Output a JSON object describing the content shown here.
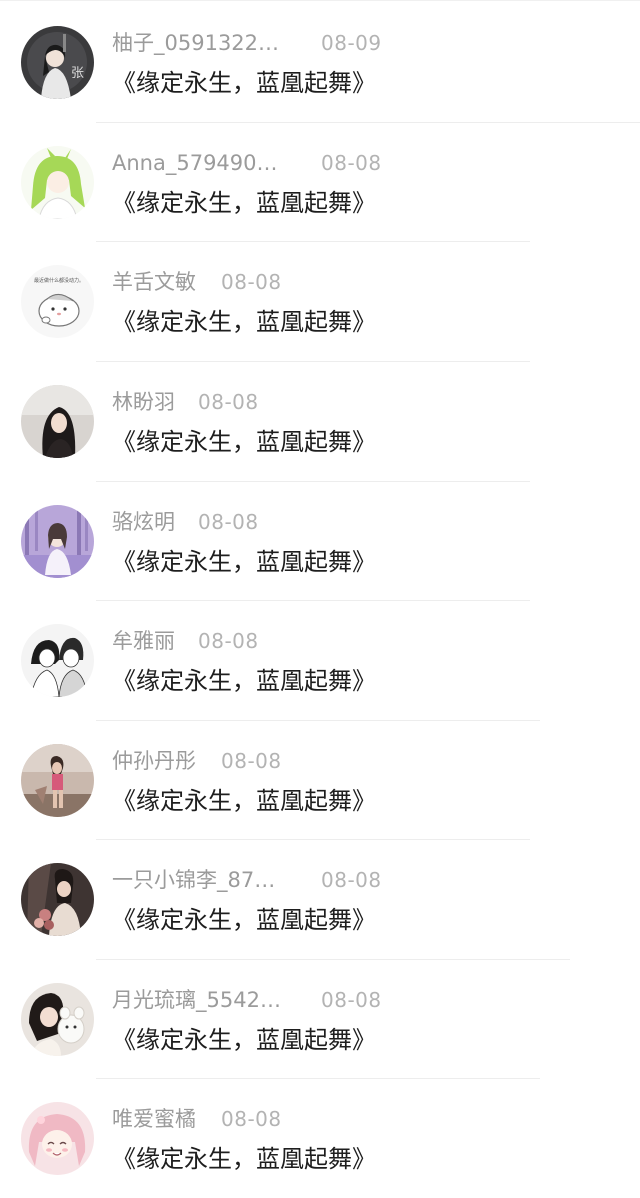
{
  "comments": [
    {
      "name": "柚子_0591322…",
      "date": "08-09",
      "title": "《缘定永生，蓝凰起舞》",
      "avatar_icon": "avatar-dark-sketch-girl"
    },
    {
      "name": "Anna_579490…",
      "date": "08-08",
      "title": "《缘定永生，蓝凰起舞》",
      "avatar_icon": "avatar-green-hair-anime"
    },
    {
      "name": "羊舌文敏",
      "date": "08-08",
      "title": "《缘定永生，蓝凰起舞》",
      "avatar_icon": "avatar-cartoon-hamster"
    },
    {
      "name": "林盼羽",
      "date": "08-08",
      "title": "《缘定永生，蓝凰起舞》",
      "avatar_icon": "avatar-girl-dark-hair"
    },
    {
      "name": "骆炫明",
      "date": "08-08",
      "title": "《缘定永生，蓝凰起舞》",
      "avatar_icon": "avatar-girl-purple-forest"
    },
    {
      "name": "牟雅丽",
      "date": "08-08",
      "title": "《缘定永生，蓝凰起舞》",
      "avatar_icon": "avatar-manga-couple"
    },
    {
      "name": "仲孙丹彤",
      "date": "08-08",
      "title": "《缘定永生，蓝凰起舞》",
      "avatar_icon": "avatar-girl-beach"
    },
    {
      "name": "一只小锦李_87…",
      "date": "08-08",
      "title": "《缘定永生，蓝凰起舞》",
      "avatar_icon": "avatar-girl-flowers"
    },
    {
      "name": "月光琉璃_5542…",
      "date": "08-08",
      "title": "《缘定永生，蓝凰起舞》",
      "avatar_icon": "avatar-girl-plush-toy"
    },
    {
      "name": "唯爱蜜橘",
      "date": "08-08",
      "title": "《缘定永生，蓝凰起舞》",
      "avatar_icon": "avatar-pink-anime-girl"
    }
  ],
  "avatar_text": {
    "hamster_caption": "最近做什么都没动力。",
    "sketch_char": "张"
  }
}
